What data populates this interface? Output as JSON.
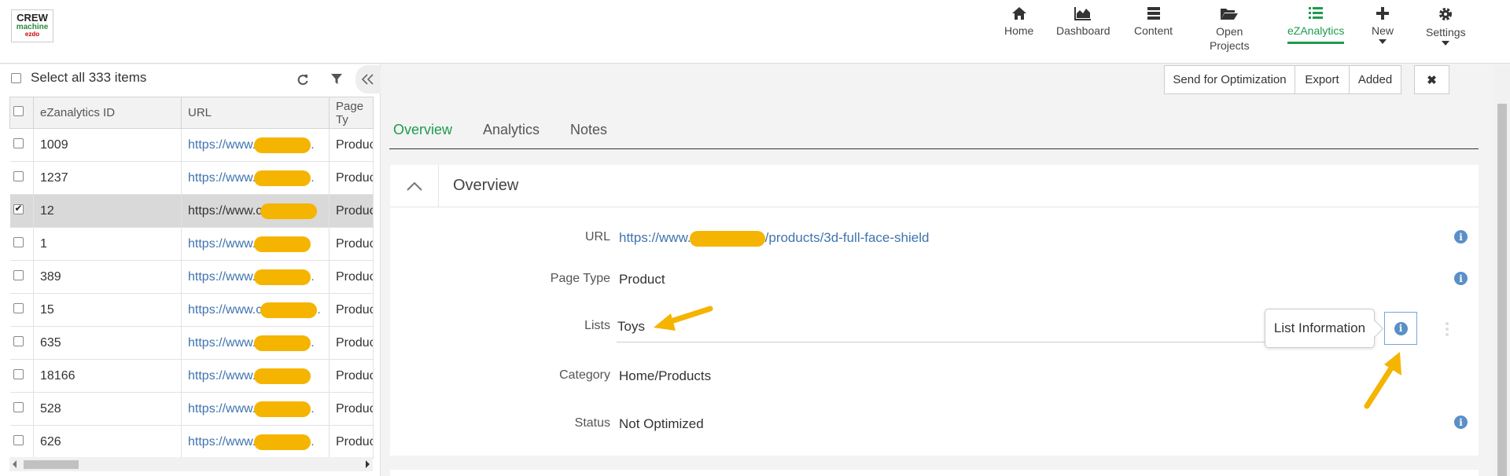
{
  "logo": {
    "line1": "CREW",
    "line2": "machine",
    "line3": "ezdo"
  },
  "nav": [
    {
      "label": "Home",
      "icon": "home-icon"
    },
    {
      "label": "Dashboard",
      "icon": "dashboard-icon"
    },
    {
      "label": "Content",
      "icon": "content-icon"
    },
    {
      "label": "Open\nProjects",
      "icon": "folder-open-icon"
    },
    {
      "label": "eZAnalytics",
      "icon": "list-icon",
      "active": true
    },
    {
      "label": "New",
      "icon": "plus-icon"
    },
    {
      "label": "Settings",
      "icon": "gear-icon"
    }
  ],
  "list_panel": {
    "select_all_label": "Select all 333 items",
    "columns": [
      "eZanalytics ID",
      "URL",
      "Page Ty"
    ],
    "rows": [
      {
        "id": "1009",
        "url": "https://www.",
        "tail": ".",
        "page_type": "Produc",
        "selected": false
      },
      {
        "id": "1237",
        "url": "https://www.",
        "tail": ".",
        "page_type": "Produc",
        "selected": false
      },
      {
        "id": "12",
        "url": "https://www.c",
        "tail": "",
        "page_type": "Produc",
        "selected": true
      },
      {
        "id": "1",
        "url": "https://www.",
        "tail": "",
        "page_type": "Produc",
        "selected": false
      },
      {
        "id": "389",
        "url": "https://www.",
        "tail": ".",
        "page_type": "Produc",
        "selected": false
      },
      {
        "id": "15",
        "url": "https://www.c",
        "tail": ".",
        "page_type": "Produc",
        "selected": false
      },
      {
        "id": "635",
        "url": "https://www.",
        "tail": ".",
        "page_type": "Produc",
        "selected": false
      },
      {
        "id": "18166",
        "url": "https://www.",
        "tail": "",
        "page_type": "Produc",
        "selected": false
      },
      {
        "id": "528",
        "url": "https://www.",
        "tail": ".",
        "page_type": "Produc",
        "selected": false
      },
      {
        "id": "626",
        "url": "https://www.",
        "tail": ".",
        "page_type": "Produc",
        "selected": false
      }
    ]
  },
  "actions": {
    "send": "Send for Optimization",
    "export": "Export",
    "added": "Added",
    "close": "✖"
  },
  "tabs": [
    "Overview",
    "Analytics",
    "Notes"
  ],
  "overview": {
    "title": "Overview",
    "url_label": "URL",
    "url_prefix": "https://www.",
    "url_suffix": "/products/3d-full-face-shield",
    "page_type_label": "Page Type",
    "page_type_value": "Product",
    "lists_label": "Lists",
    "lists_value": "Toys",
    "category_label": "Category",
    "category_value": "Home/Products",
    "status_label": "Status",
    "status_value": "Not Optimized",
    "tooltip": "List Information",
    "info_glyph": "i"
  },
  "colors": {
    "accent": "#1e9b4f",
    "link": "#3f74b0",
    "redaction": "#f5b400",
    "annotation_arrow": "#f5b400"
  }
}
